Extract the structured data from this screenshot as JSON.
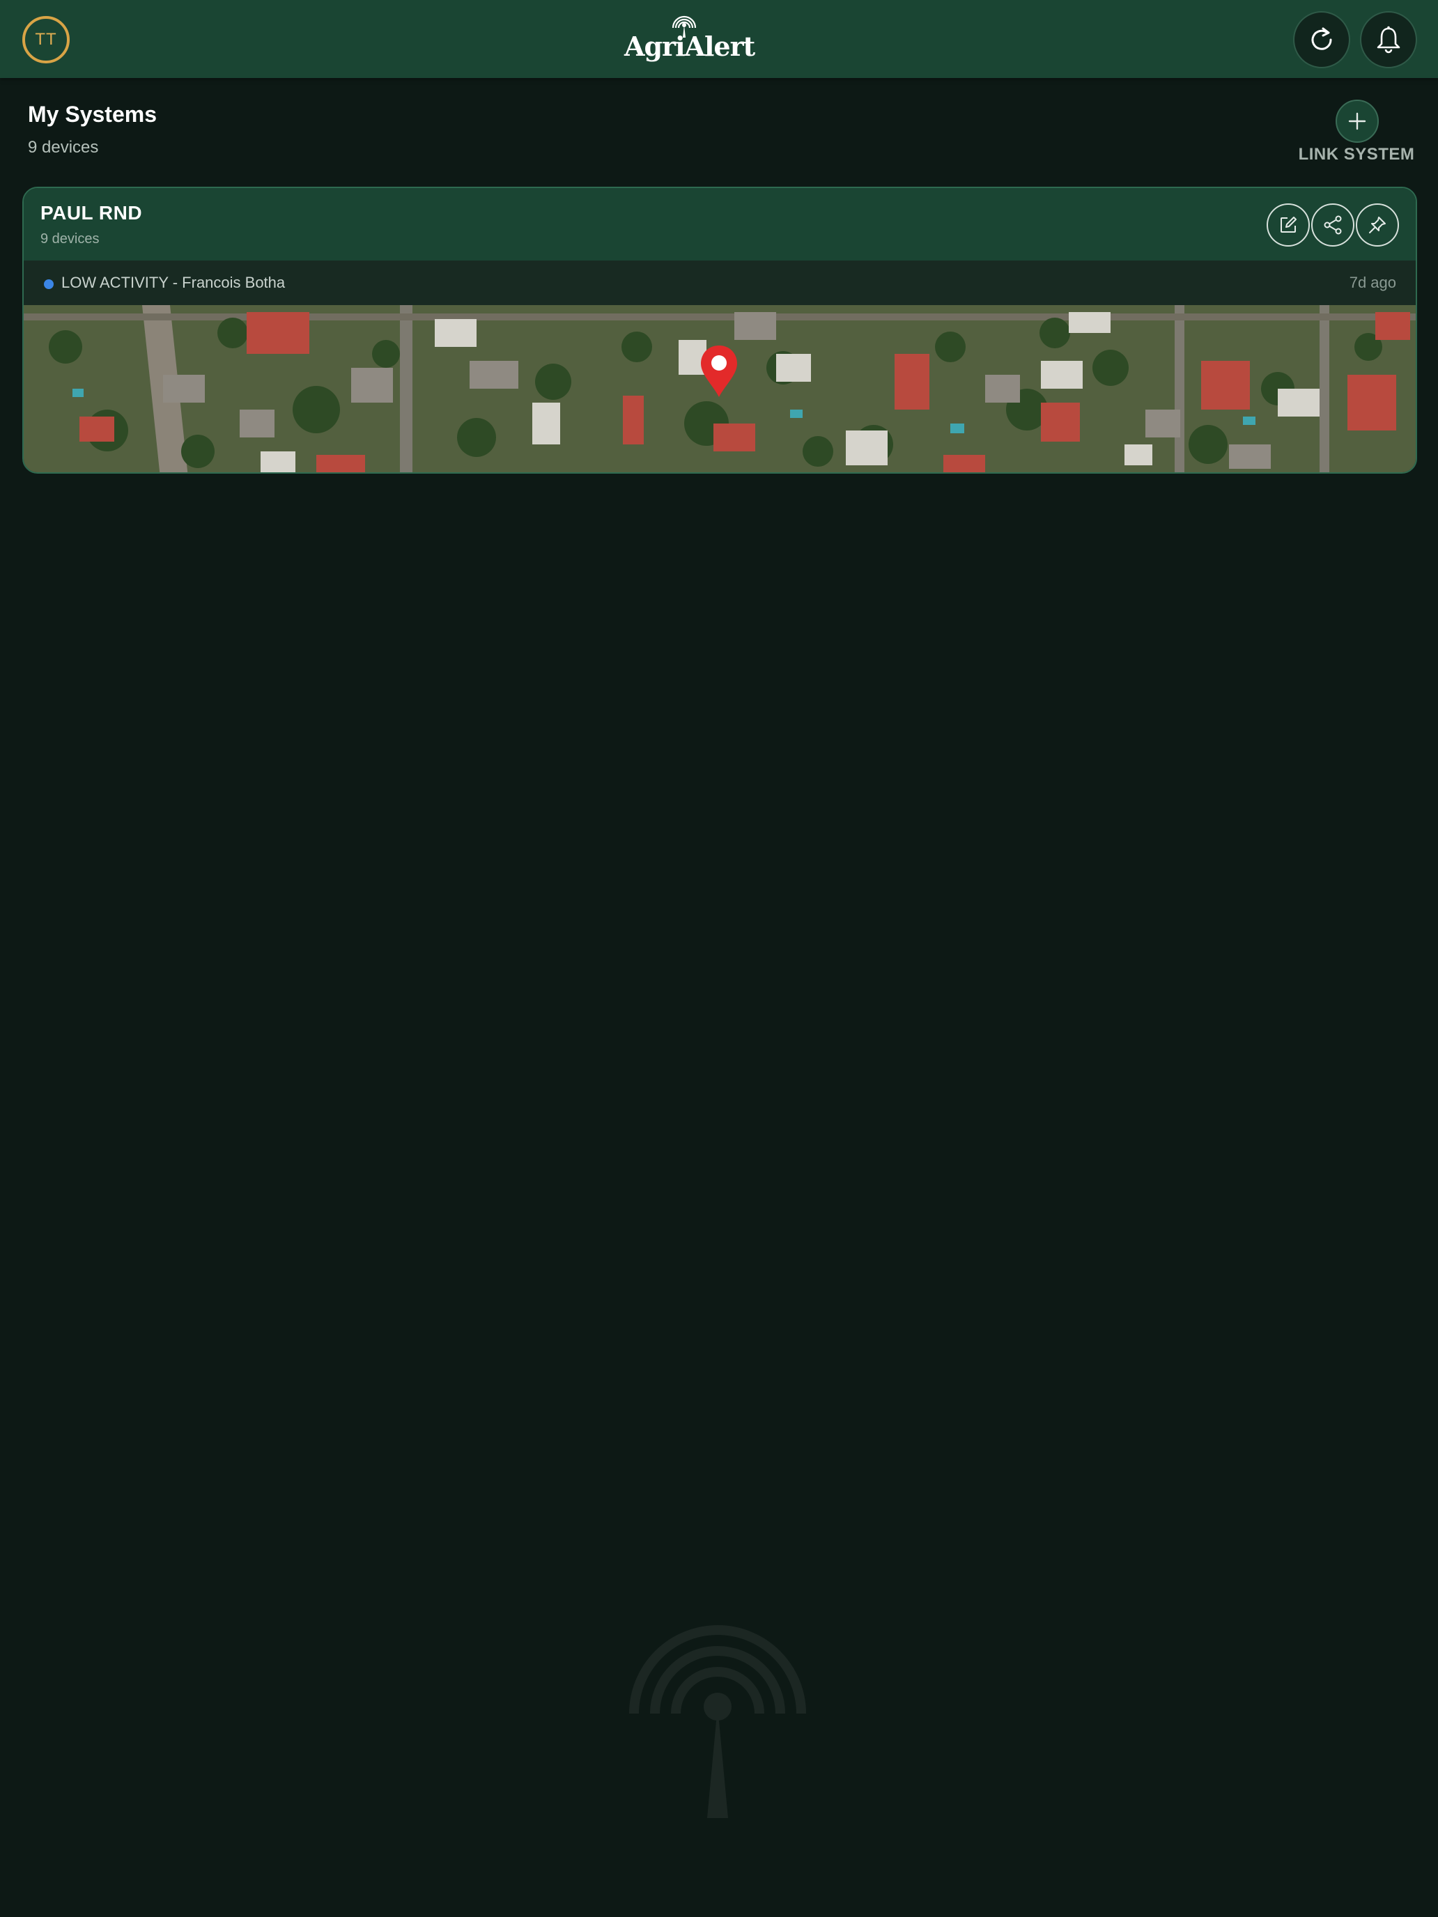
{
  "header": {
    "avatar_initials": "TT",
    "logo_text": "AgriAlert",
    "refresh_icon": "refresh-icon",
    "bell_icon": "bell-icon"
  },
  "systems": {
    "title": "My Systems",
    "subtitle": "9 devices",
    "link_label": "LINK SYSTEM",
    "link_icon": "plus-icon"
  },
  "card": {
    "name": "PAUL RND",
    "devices": "9 devices",
    "actions": [
      "edit-icon",
      "share-icon",
      "pin-icon"
    ],
    "activity": {
      "text": "LOW ACTIVITY - Francois Botha",
      "time": "7d ago",
      "dot_color": "#3b86e6"
    },
    "map_pin_icon": "map-pin-icon"
  },
  "colors": {
    "header_bg": "#1a4533",
    "page_bg": "#0d1915",
    "avatar_ring": "#d9a446"
  }
}
